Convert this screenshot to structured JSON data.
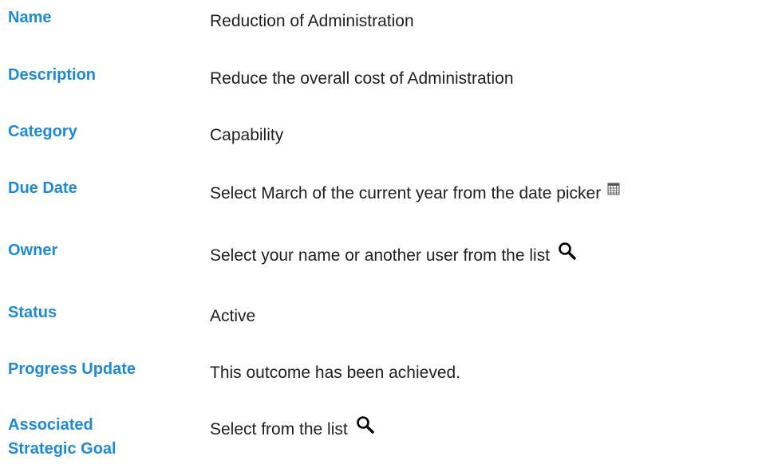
{
  "fields": [
    {
      "label": "Name",
      "value": "Reduction of Administration"
    },
    {
      "label": "Description",
      "value": "Reduce the overall cost of Administration"
    },
    {
      "label": "Category",
      "value": "Capability"
    },
    {
      "label": "Due Date",
      "value": "Select March of the current year from the date picker",
      "icon": "calendar-icon"
    },
    {
      "label": "Owner",
      "value": "Select your name or another user from the list",
      "icon": "search-icon"
    },
    {
      "label": "Status",
      "value": "Active"
    },
    {
      "label": "Progress Update",
      "value": "This outcome has been achieved."
    },
    {
      "label": "Associated Strategic Goal",
      "value": "Select from the list",
      "icon": "search-icon"
    }
  ],
  "colors": {
    "label": "#1e8ad6",
    "value": "#1f1f1f",
    "background": "#ffffff"
  }
}
